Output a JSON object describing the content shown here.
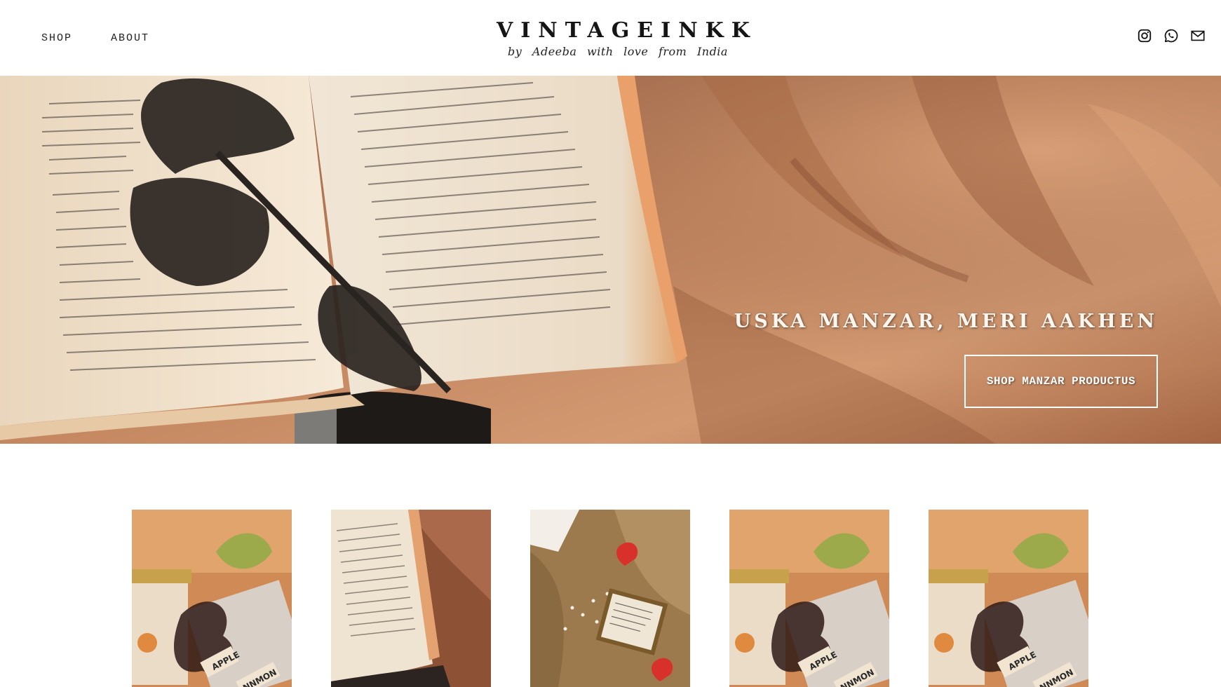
{
  "nav": {
    "items": [
      {
        "label": "SHOP"
      },
      {
        "label": "ABOUT"
      }
    ]
  },
  "logo": {
    "title": "VINTAGEINKK",
    "subtitle": "by Adeeba with love from India"
  },
  "social": {
    "icons": [
      "instagram-icon",
      "whatsapp-icon",
      "mail-icon"
    ]
  },
  "hero": {
    "heading": "USKA MANZAR, MERI AAKHEN",
    "button_label": "SHOP MANZAR PRODUCTUS"
  },
  "products": [
    {
      "image": "apple-cinnamon-jar"
    },
    {
      "image": "open-book-on-fabric"
    },
    {
      "image": "framed-quote-with-flowers"
    },
    {
      "image": "apple-cinnamon-jar"
    },
    {
      "image": "apple-cinnamon-jar"
    }
  ],
  "product_labels": {
    "jar_label_1": "APPLE",
    "jar_label_2": "NNMON"
  },
  "colors": {
    "background": "#ffffff",
    "text": "#151515",
    "hero_tan": "#c58a63",
    "hero_dark": "#5a3a2c",
    "page_cream": "#efe3cf"
  }
}
